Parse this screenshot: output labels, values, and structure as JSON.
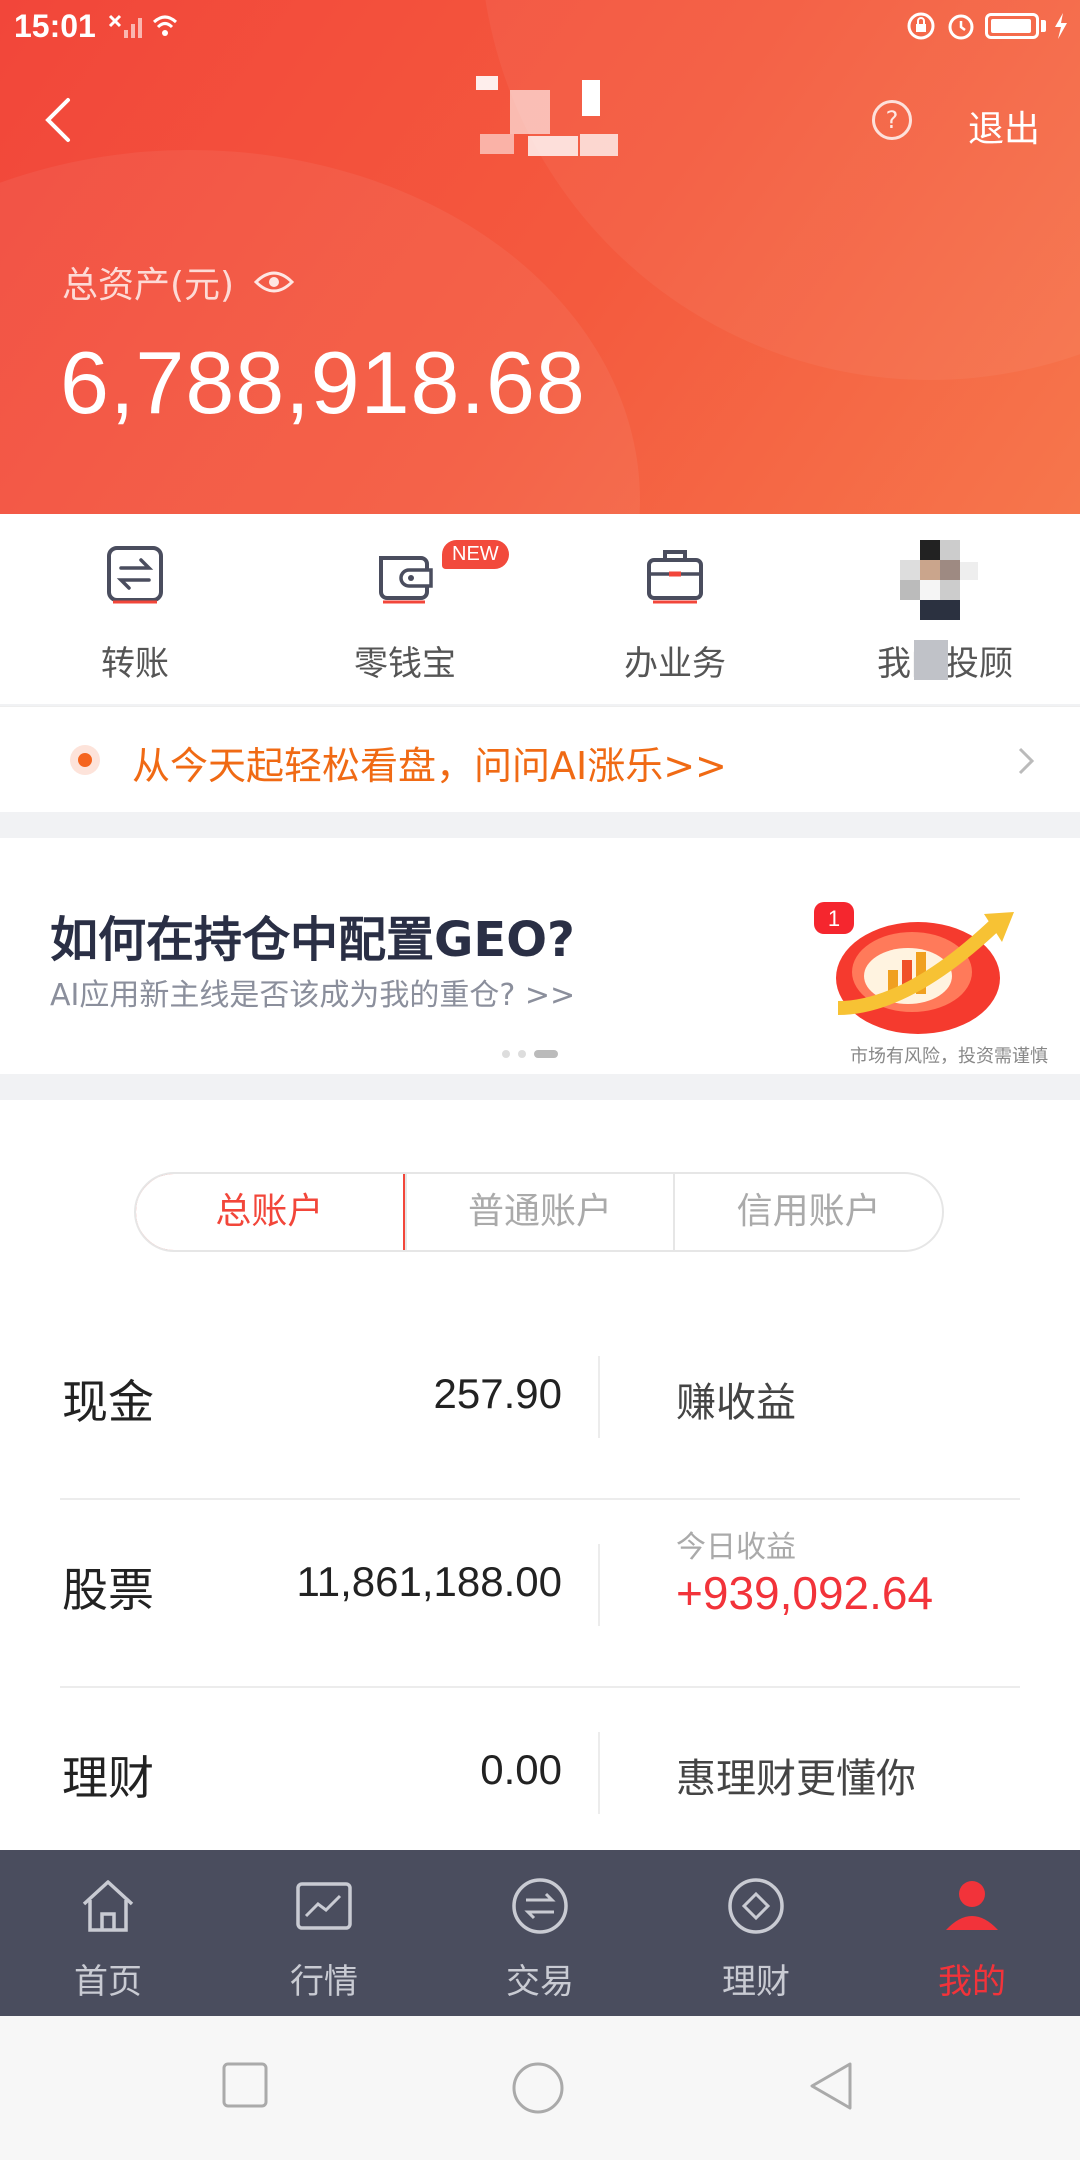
{
  "status_bar": {
    "time": "15:01"
  },
  "header": {
    "logout_label": "退出",
    "help_symbol": "?",
    "total_assets_label": "总资产(元)",
    "total_assets_value": "6,788,918.68"
  },
  "quick_actions": {
    "items": [
      {
        "label": "转账",
        "icon": "transfer-icon"
      },
      {
        "label": "零钱宝",
        "icon": "wallet-icon",
        "badge": "NEW"
      },
      {
        "label": "办业务",
        "icon": "briefcase-icon"
      },
      {
        "label": "我的投顾",
        "icon": "advisor-avatar"
      }
    ]
  },
  "ai_banner": {
    "text": "从今天起轻松看盘，问问AI涨乐>>"
  },
  "promo": {
    "title": "如何在持仓中配置GEO?",
    "subtitle": "AI应用新主线是否该成为我的重仓? >>",
    "risk_note": "市场有风险，投资需谨慎",
    "badge_number": "1"
  },
  "accounts": {
    "tabs": [
      "总账户",
      "普通账户",
      "信用账户"
    ],
    "active_tab": 0,
    "rows": [
      {
        "name": "现金",
        "value": "257.90",
        "side": "赚收益"
      },
      {
        "name": "股票",
        "value": "11,861,188.00",
        "side_label": "今日收益",
        "side_value": "+939,092.64"
      },
      {
        "name": "理财",
        "value": "0.00",
        "side": "惠理财更懂你"
      }
    ]
  },
  "bottom_nav": {
    "items": [
      {
        "label": "首页",
        "icon": "home-icon"
      },
      {
        "label": "行情",
        "icon": "market-chart-icon"
      },
      {
        "label": "交易",
        "icon": "trade-icon"
      },
      {
        "label": "理财",
        "icon": "wealth-icon"
      },
      {
        "label": "我的",
        "icon": "profile-icon"
      }
    ],
    "active_index": 4
  },
  "colors": {
    "brand_red": "#f2463a",
    "profit_red": "#f2333a",
    "ai_orange": "#f06a14",
    "nav_bg": "#4a4d5e"
  }
}
